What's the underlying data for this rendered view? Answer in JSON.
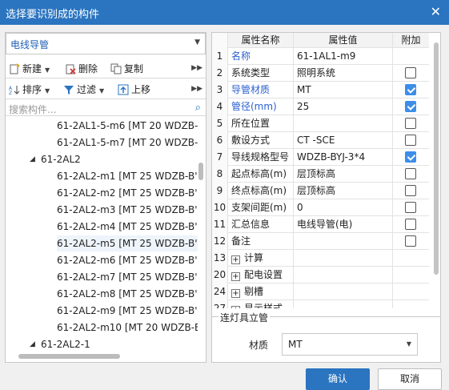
{
  "window": {
    "title": "选择要识别成的构件",
    "close_glyph": "✕"
  },
  "left": {
    "category_select": "电线导管",
    "toolbar1": {
      "new": "新建",
      "delete": "删除",
      "copy": "复制"
    },
    "toolbar2": {
      "sort": "排序",
      "filter": "过滤",
      "move_up": "上移"
    },
    "search_placeholder": "搜索构件...",
    "tree": [
      {
        "text": "61-2AL1-5-m6 [MT 20 WDZB-",
        "level": 2
      },
      {
        "text": "61-2AL1-5-m7 [MT 20 WDZB-",
        "level": 2
      },
      {
        "text": "61-2AL2",
        "level": 1
      },
      {
        "text": "61-2AL2-m1 [MT 25 WDZB-B'",
        "level": 2
      },
      {
        "text": "61-2AL2-m2 [MT 25 WDZB-B'",
        "level": 2
      },
      {
        "text": "61-2AL2-m3 [MT 25 WDZB-B'",
        "level": 2
      },
      {
        "text": "61-2AL2-m4 [MT 25 WDZB-B'",
        "level": 2
      },
      {
        "text": "61-2AL2-m5 [MT 25 WDZB-B'",
        "level": 2,
        "selected": true
      },
      {
        "text": "61-2AL2-m6 [MT 25 WDZB-B'",
        "level": 2
      },
      {
        "text": "61-2AL2-m7 [MT 25 WDZB-B'",
        "level": 2
      },
      {
        "text": "61-2AL2-m8 [MT 25 WDZB-B'",
        "level": 2
      },
      {
        "text": "61-2AL2-m9 [MT 25 WDZB-B'",
        "level": 2
      },
      {
        "text": "61-2AL2-m10 [MT 20 WDZB-E",
        "level": 2
      },
      {
        "text": "61-2AL2-1",
        "level": 1
      }
    ]
  },
  "grid": {
    "headers": [
      "属性名称",
      "属性值",
      "附加"
    ],
    "rows": [
      {
        "n": "1",
        "name": "名称",
        "value": "61-1AL1-m9",
        "blue": true,
        "check": null
      },
      {
        "n": "2",
        "name": "系统类型",
        "value": "照明系统",
        "check": false
      },
      {
        "n": "3",
        "name": "导管材质",
        "value": "MT",
        "blue": true,
        "check": true
      },
      {
        "n": "4",
        "name": "管径(mm)",
        "value": "25",
        "blue": true,
        "check": true
      },
      {
        "n": "5",
        "name": "所在位置",
        "value": "",
        "check": false
      },
      {
        "n": "6",
        "name": "敷设方式",
        "value": "CT -SCE",
        "check": false
      },
      {
        "n": "7",
        "name": "导线规格型号",
        "value": "WDZB-BYJ-3*4",
        "check": true
      },
      {
        "n": "8",
        "name": "起点标高(m)",
        "value": "层顶标高",
        "check": false
      },
      {
        "n": "9",
        "name": "终点标高(m)",
        "value": "层顶标高",
        "check": false
      },
      {
        "n": "10",
        "name": "支架间距(m)",
        "value": "0",
        "check": false
      },
      {
        "n": "11",
        "name": "汇总信息",
        "value": "电线导管(电)",
        "check": false
      },
      {
        "n": "12",
        "name": "备注",
        "value": "",
        "check": false
      },
      {
        "n": "13",
        "name": "计算",
        "value": "",
        "group": true,
        "check": null
      },
      {
        "n": "20",
        "name": "配电设置",
        "value": "",
        "group": true,
        "check": null
      },
      {
        "n": "24",
        "name": "剔槽",
        "value": "",
        "group": true,
        "check": null
      },
      {
        "n": "27",
        "name": "显示样式",
        "value": "",
        "group": true,
        "check": null
      }
    ]
  },
  "group": {
    "title": "连灯具立管",
    "material_label": "材质",
    "material_value": "MT"
  },
  "buttons": {
    "ok": "确认",
    "cancel": "取消"
  }
}
